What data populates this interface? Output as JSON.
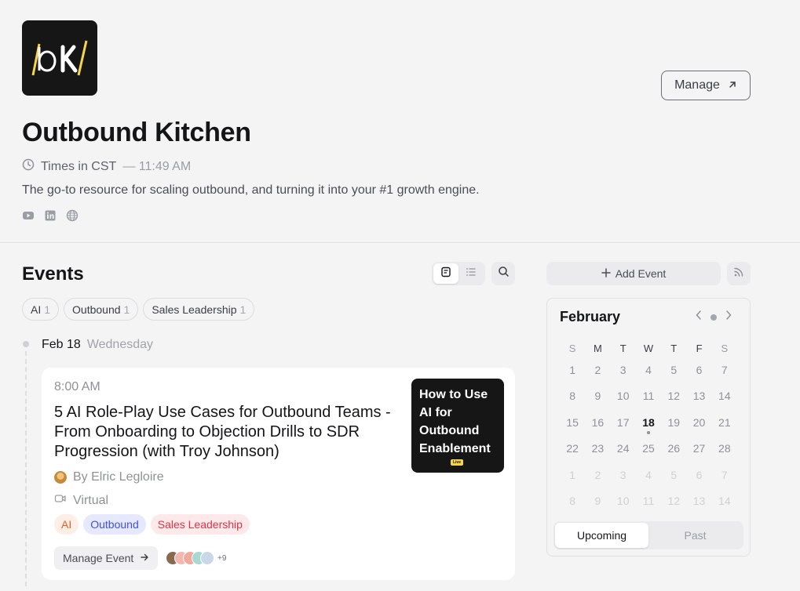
{
  "calendar_brand": {
    "name": "Outbound Kitchen",
    "manage_label": "Manage",
    "timezone_label": "Times in CST",
    "current_time": "— 11:49 AM",
    "description": "The go-to resource for scaling outbound, and turning it into your #1 growth engine.",
    "socials": [
      "youtube-icon",
      "linkedin-icon",
      "globe-icon"
    ],
    "logo_colors": {
      "background": "#161616",
      "accent": "#f6d54a"
    }
  },
  "events": {
    "title": "Events",
    "filters": [
      {
        "label": "AI",
        "count": "1"
      },
      {
        "label": "Outbound",
        "count": "1"
      },
      {
        "label": "Sales Leadership",
        "count": "1"
      }
    ],
    "date_group": {
      "date": "Feb 18",
      "weekday": "Wednesday"
    },
    "event": {
      "time": "8:00 AM",
      "title": "5 AI Role-Play Use Cases for Outbound Teams - From Onboarding to Objection Drills to SDR Progression (with Troy Johnson)",
      "host": "By Elric Legloire",
      "location": "Virtual",
      "tags": [
        "AI",
        "Outbound",
        "Sales Leadership"
      ],
      "manage_label": "Manage Event",
      "extra_guests": "+9",
      "thumbnail_text": "How to Use AI for Outbound Enablement",
      "thumbnail_badge": "Live"
    }
  },
  "sidebar": {
    "add_event_label": "Add Event",
    "calendar": {
      "month": "February",
      "weekdays": [
        "S",
        "M",
        "T",
        "W",
        "T",
        "F",
        "S"
      ],
      "today": 18,
      "weeks": [
        [
          "1",
          "2",
          "3",
          "4",
          "5",
          "6",
          "7"
        ],
        [
          "8",
          "9",
          "10",
          "11",
          "12",
          "13",
          "14"
        ],
        [
          "15",
          "16",
          "17",
          "18",
          "19",
          "20",
          "21"
        ],
        [
          "22",
          "23",
          "24",
          "25",
          "26",
          "27",
          "28"
        ],
        [
          "1",
          "2",
          "3",
          "4",
          "5",
          "6",
          "7"
        ],
        [
          "8",
          "9",
          "10",
          "11",
          "12",
          "13",
          "14"
        ]
      ],
      "tabs": {
        "upcoming": "Upcoming",
        "past": "Past"
      }
    }
  },
  "colors": {
    "tag_ai": "#e3602b",
    "tag_outbound": "#3f52e0",
    "tag_sales": "#dc3545"
  }
}
